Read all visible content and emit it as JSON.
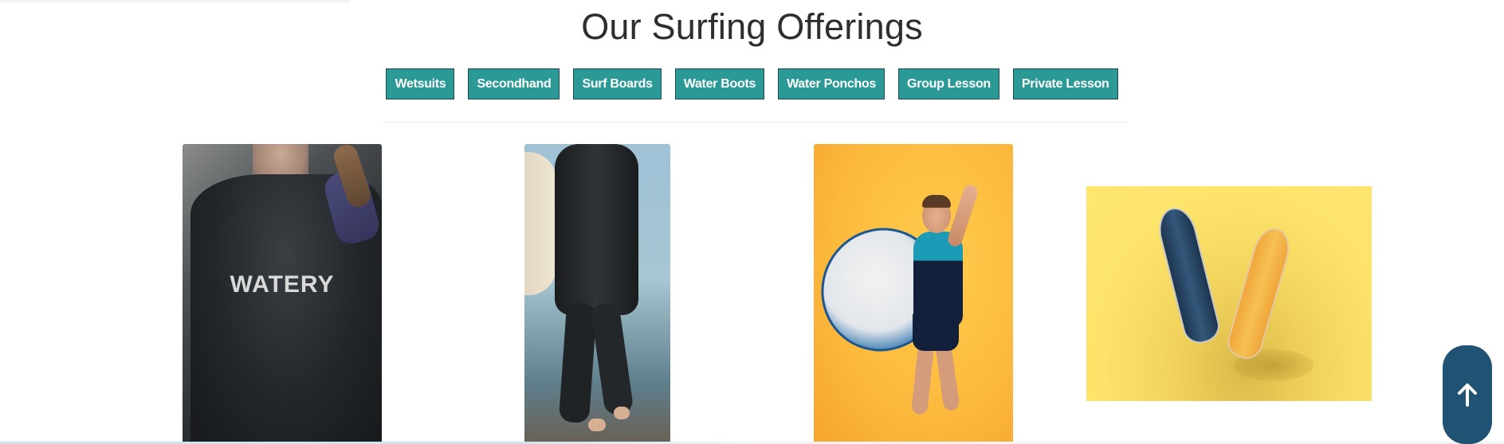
{
  "section": {
    "title": "Our Surfing Offerings"
  },
  "filters": [
    {
      "label": "Wetsuits"
    },
    {
      "label": "Secondhand"
    },
    {
      "label": "Surf Boards"
    },
    {
      "label": "Water Boots"
    },
    {
      "label": "Water Ponchos"
    },
    {
      "label": "Group Lesson"
    },
    {
      "label": "Private Lesson"
    }
  ],
  "gallery": {
    "items": [
      {
        "subject": "wetsuit close-up",
        "brand_text": "WATERY"
      },
      {
        "subject": "surfer walking in wetsuit"
      },
      {
        "subject": "surfer holding surfboard on orange backdrop"
      },
      {
        "subject": "two surfboards on yellow backdrop"
      }
    ]
  },
  "colors": {
    "filter_bg": "#2b9a97",
    "filter_border": "#1f4a52",
    "scroll_top_bg": "#1f5273",
    "title_text": "#2e2e2e"
  },
  "icons": {
    "scroll_top": "arrow-up-icon"
  }
}
